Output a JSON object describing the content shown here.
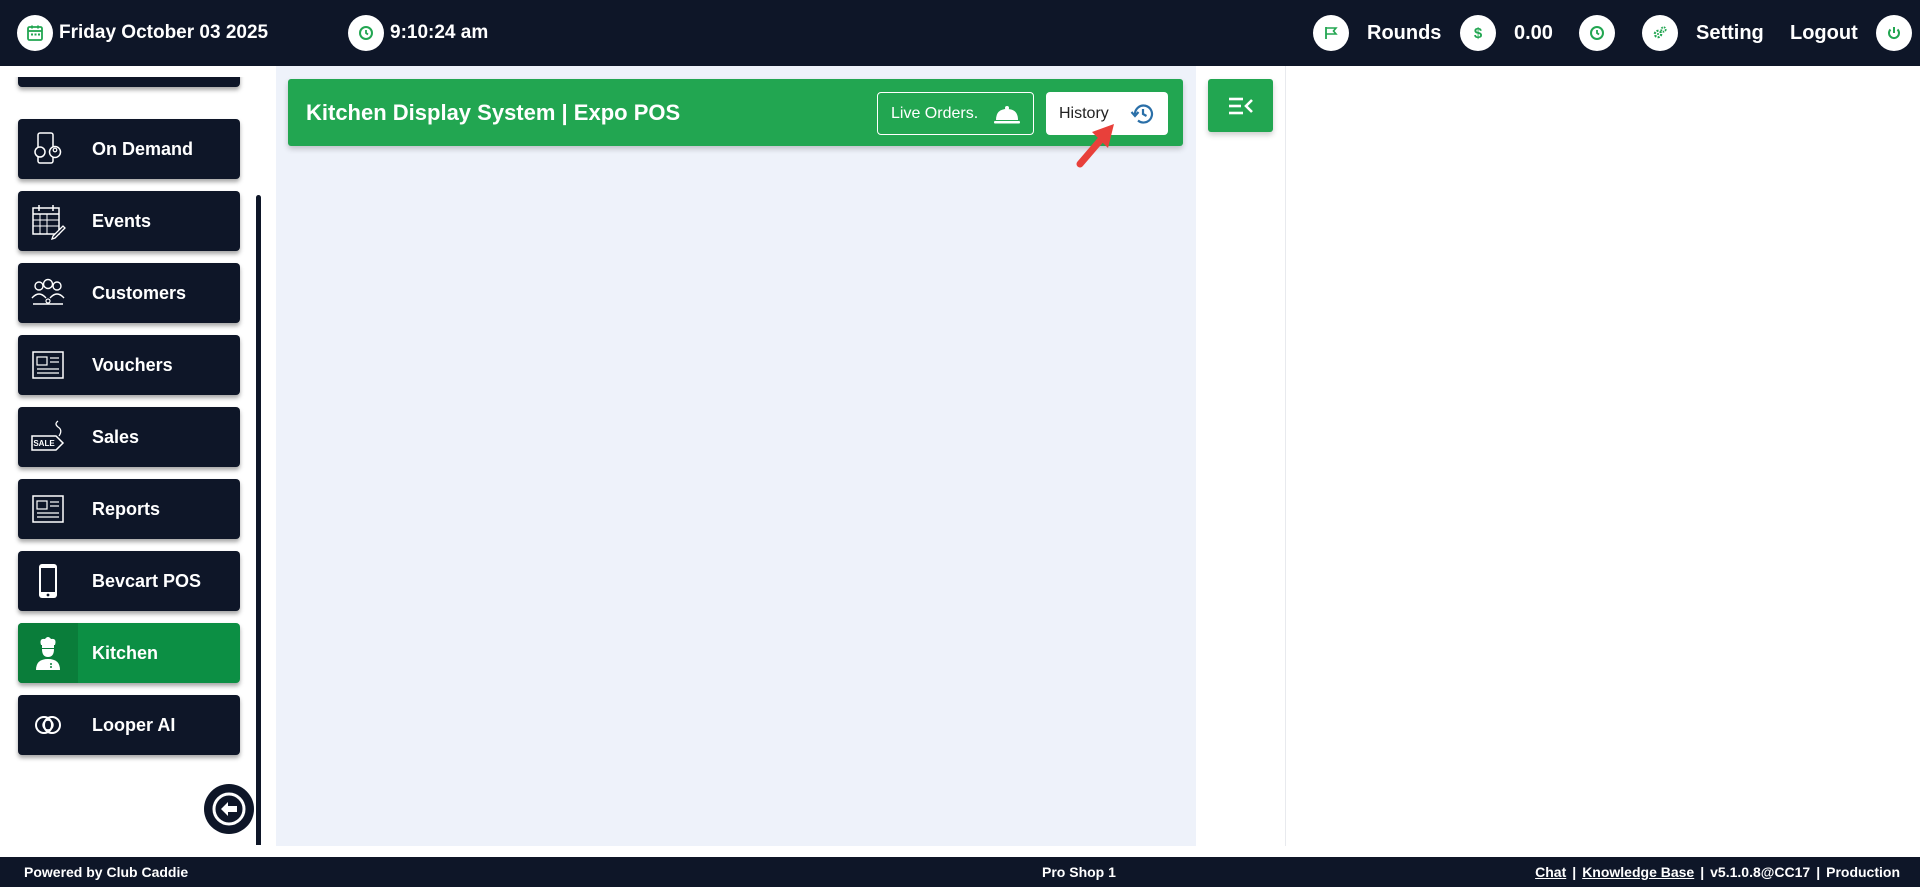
{
  "topbar": {
    "date": "Friday October 03 2025",
    "time": "9:10:24 am",
    "rounds_label": "Rounds",
    "balance": "0.00",
    "setting_label": "Setting",
    "logout_label": "Logout"
  },
  "sidebar": {
    "items": [
      {
        "label": "On Demand",
        "icon": "on-demand-icon"
      },
      {
        "label": "Events",
        "icon": "calendar-icon"
      },
      {
        "label": "Customers",
        "icon": "customers-icon"
      },
      {
        "label": "Vouchers",
        "icon": "voucher-icon"
      },
      {
        "label": "Sales",
        "icon": "sale-tag-icon"
      },
      {
        "label": "Reports",
        "icon": "report-icon"
      },
      {
        "label": "Bevcart POS",
        "icon": "phone-icon"
      },
      {
        "label": "Kitchen",
        "icon": "chef-icon",
        "active": true
      },
      {
        "label": "Looper AI",
        "icon": "looper-icon"
      }
    ]
  },
  "kds": {
    "title": "Kitchen Display System | Expo POS",
    "live_orders_label": "Live Orders.",
    "history_label": "History"
  },
  "footer": {
    "powered_by": "Powered by Club Caddie",
    "location": "Pro Shop 1",
    "chat_link": "Chat",
    "kb_link": "Knowledge Base",
    "version": "v5.1.0.8@CC17",
    "environment": "Production"
  },
  "colors": {
    "navy": "#0e1628",
    "green": "#22a651",
    "active_green": "#0c8f44",
    "panel_bg": "#eef2fa"
  }
}
